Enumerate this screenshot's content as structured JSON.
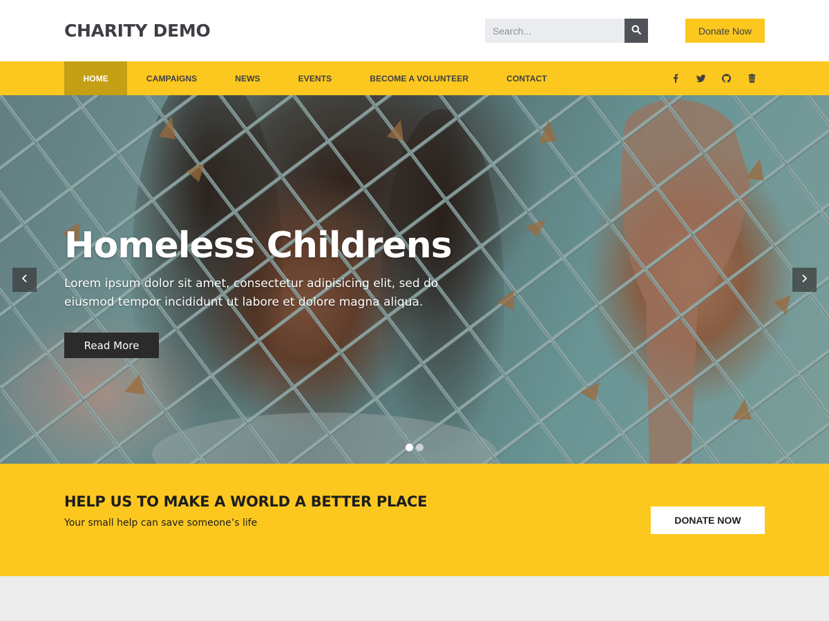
{
  "header": {
    "logo": "CHARITY DEMO",
    "search_placeholder": "Search...",
    "donate_label": "Donate Now"
  },
  "nav": {
    "items": [
      {
        "label": "HOME",
        "active": true
      },
      {
        "label": "CAMPAIGNS",
        "active": false
      },
      {
        "label": "NEWS",
        "active": false
      },
      {
        "label": "EVENTS",
        "active": false
      },
      {
        "label": "BECOME A VOLUNTEER",
        "active": false
      },
      {
        "label": "CONTACT",
        "active": false
      }
    ],
    "social_icons": [
      "facebook-icon",
      "twitter-icon",
      "github-icon",
      "trash-icon"
    ]
  },
  "hero": {
    "title": "Homeless Childrens",
    "text": "Lorem ipsum dolor sit amet, consectetur adipisicing elit, sed do eiusmod tempor incididunt ut labore et dolore magna aliqua.",
    "button_label": "Read More",
    "slide_count": 2,
    "active_slide": 1
  },
  "cta": {
    "title": "HELP US TO MAKE A WORLD A BETTER PLACE",
    "subtitle": "Your small help can save someone’s life",
    "button_label": "DONATE NOW"
  },
  "colors": {
    "accent": "#fcc81f",
    "accent_dark": "#c59f14",
    "text_dark": "#3d3f45"
  }
}
